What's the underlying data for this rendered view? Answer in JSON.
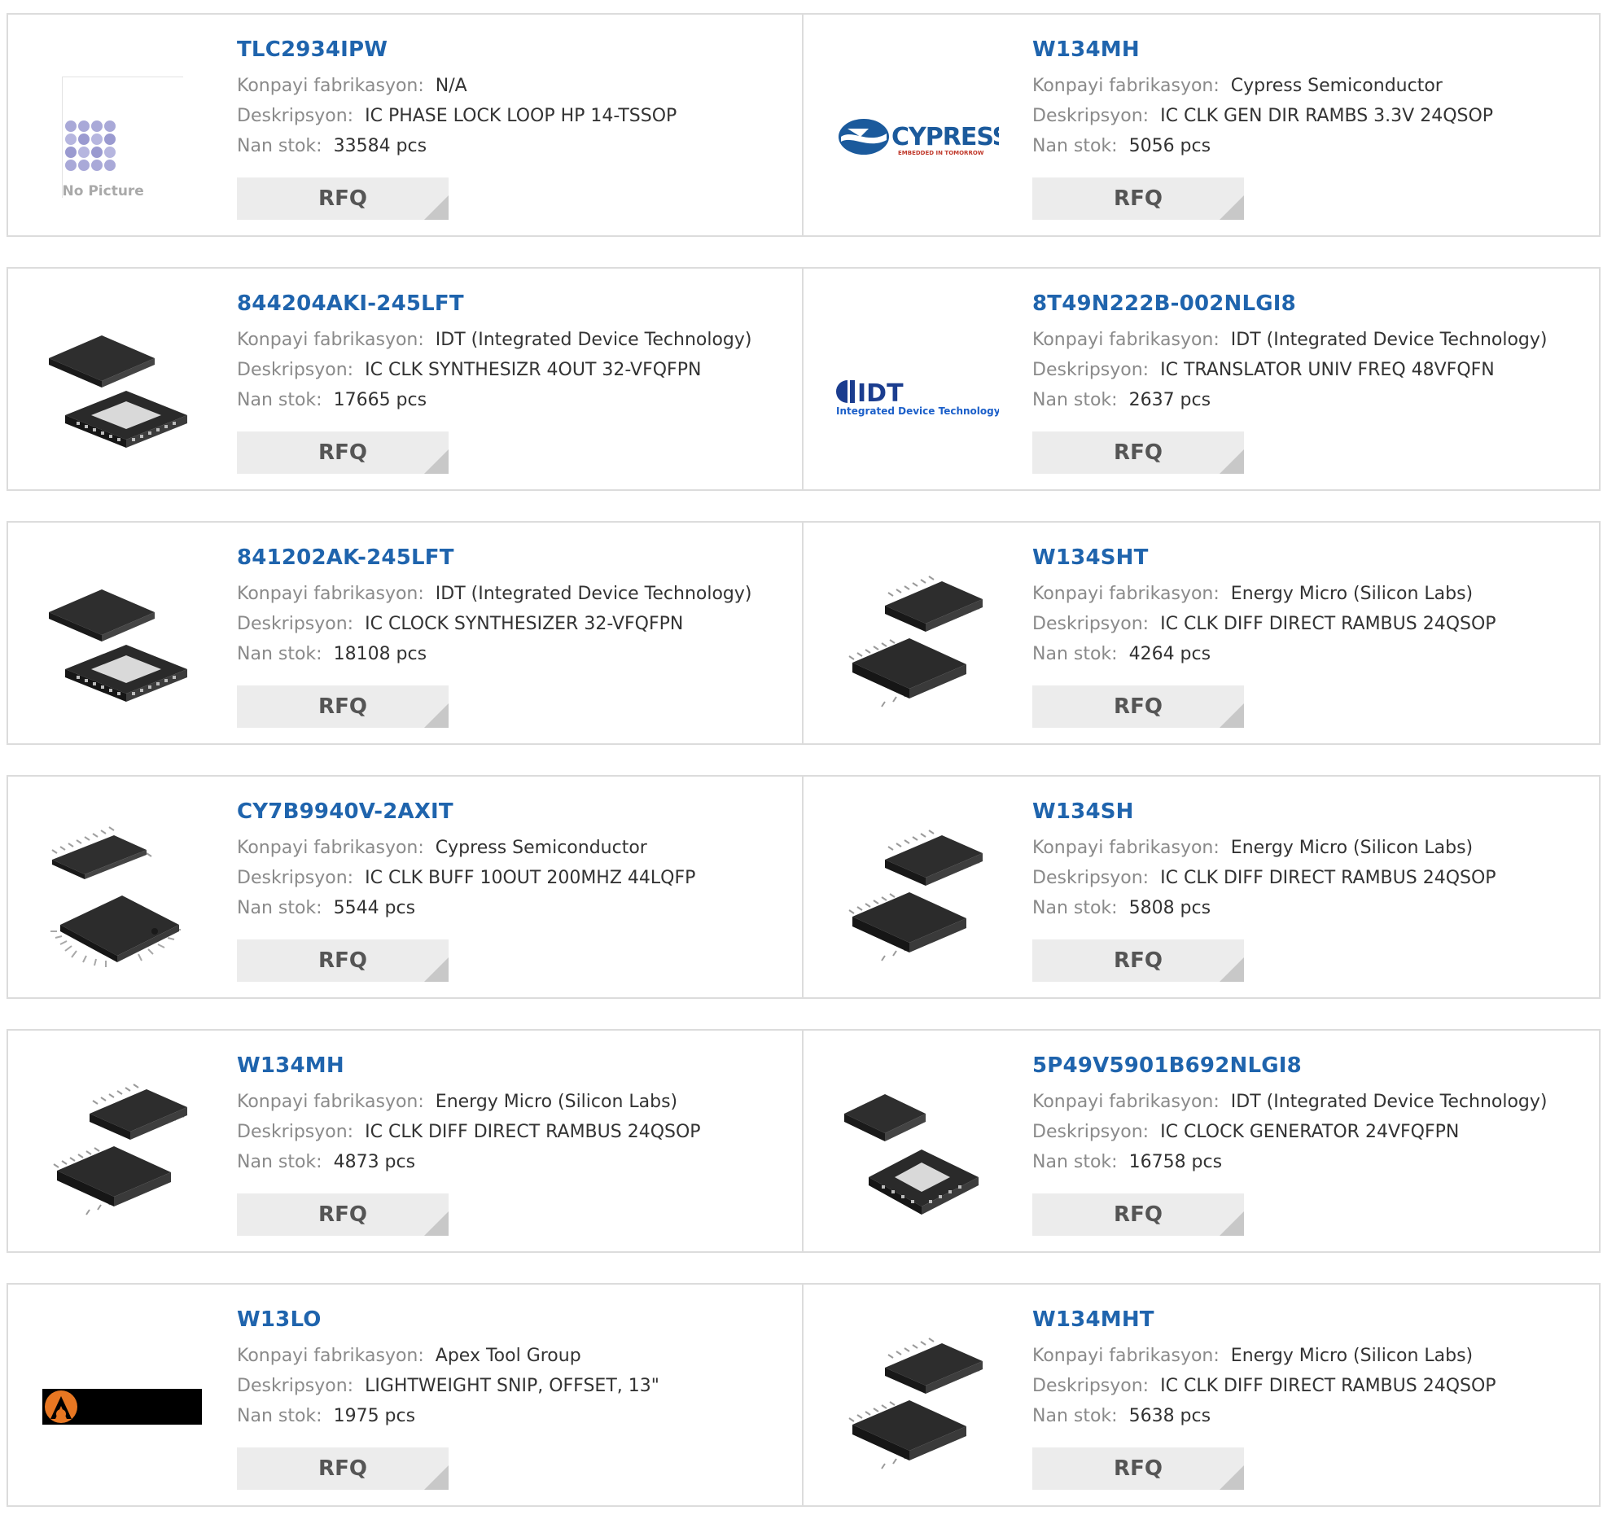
{
  "labels": {
    "manufacturer": "Konpayi fabrikasyon:",
    "description": "Deskripsyon:",
    "stock": "Nan stok:",
    "rfq": "RFQ"
  },
  "no_picture_text": "No Picture",
  "logos": {
    "cypress": "CYPRESS",
    "cypress_tagline": "EMBEDDED IN TOMORROW",
    "idt": "IDT",
    "idt_tagline": "Integrated Device Technology"
  },
  "products": [
    {
      "part": "TLC2934IPW",
      "manufacturer": "N/A",
      "description": "IC PHASE LOCK LOOP HP 14-TSSOP",
      "stock": "33584 pcs",
      "image": "no-picture-icon"
    },
    {
      "part": "W134MH",
      "manufacturer": "Cypress Semiconductor",
      "description": "IC CLK GEN DIR RAMBS 3.3V 24QSOP",
      "stock": "5056 pcs",
      "image": "cypress-logo"
    },
    {
      "part": "844204AKI-245LFT",
      "manufacturer": "IDT (Integrated Device Technology)",
      "description": "IC CLK SYNTHESIZR 4OUT 32-VFQFPN",
      "stock": "17665 pcs",
      "image": "qfn-chip-icon"
    },
    {
      "part": "8T49N222B-002NLGI8",
      "manufacturer": "IDT (Integrated Device Technology)",
      "description": "IC TRANSLATOR UNIV FREQ 48VFQFN",
      "stock": "2637 pcs",
      "image": "idt-logo"
    },
    {
      "part": "841202AK-245LFT",
      "manufacturer": "IDT (Integrated Device Technology)",
      "description": "IC CLOCK SYNTHESIZER 32-VFQFPN",
      "stock": "18108 pcs",
      "image": "qfn-chip-icon"
    },
    {
      "part": "W134SHT",
      "manufacturer": "Energy Micro (Silicon Labs)",
      "description": "IC CLK DIFF DIRECT RAMBUS 24QSOP",
      "stock": "4264 pcs",
      "image": "qsop-chip-icon"
    },
    {
      "part": "CY7B9940V-2AXIT",
      "manufacturer": "Cypress Semiconductor",
      "description": "IC CLK BUFF 10OUT 200MHZ 44LQFP",
      "stock": "5544 pcs",
      "image": "lqfp-chip-icon"
    },
    {
      "part": "W134SH",
      "manufacturer": "Energy Micro (Silicon Labs)",
      "description": "IC CLK DIFF DIRECT RAMBUS 24QSOP",
      "stock": "5808 pcs",
      "image": "qsop-chip-icon"
    },
    {
      "part": "W134MH",
      "manufacturer": "Energy Micro (Silicon Labs)",
      "description": "IC CLK DIFF DIRECT RAMBUS 24QSOP",
      "stock": "4873 pcs",
      "image": "qsop-chip-icon"
    },
    {
      "part": "5P49V5901B692NLGI8",
      "manufacturer": "IDT (Integrated Device Technology)",
      "description": "IC CLOCK GENERATOR 24VFQFPN",
      "stock": "16758 pcs",
      "image": "qfn-chip-icon"
    },
    {
      "part": "W13LO",
      "manufacturer": "Apex Tool Group",
      "description": "LIGHTWEIGHT SNIP, OFFSET, 13\"",
      "stock": "1975 pcs",
      "image": "apex-logo"
    },
    {
      "part": "W134MHT",
      "manufacturer": "Energy Micro (Silicon Labs)",
      "description": "IC CLK DIFF DIRECT RAMBUS 24QSOP",
      "stock": "5638 pcs",
      "image": "qsop-chip-icon"
    }
  ]
}
